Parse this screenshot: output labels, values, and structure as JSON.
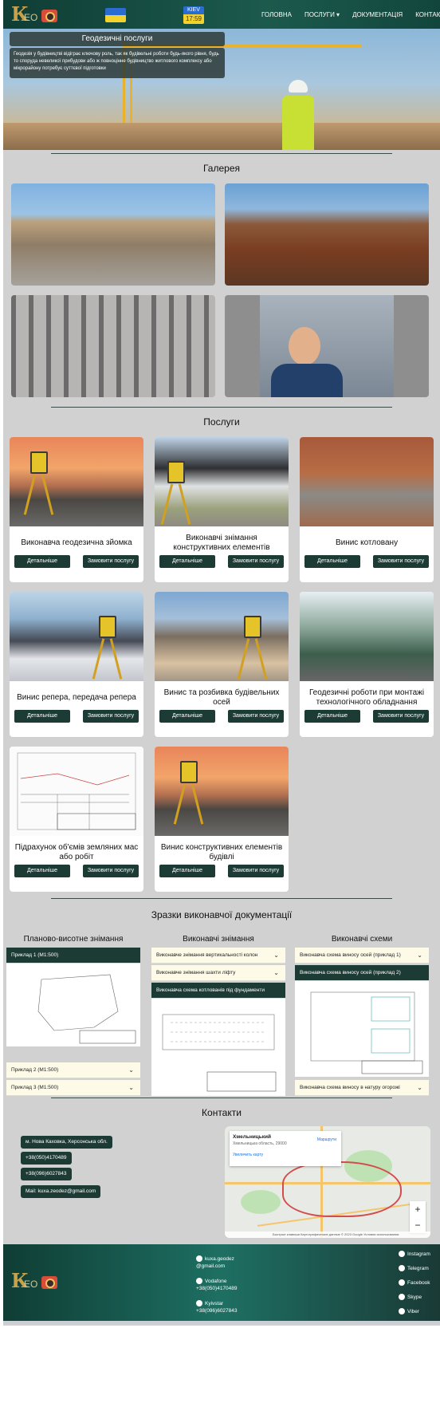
{
  "header": {
    "logo": {
      "letter": "К",
      "text": "ЕО"
    },
    "widget": {
      "city": "KIEV",
      "time": "17:59"
    },
    "nav": [
      {
        "label": "ГОЛОВНА"
      },
      {
        "label": "ПОСЛУГИ ▾"
      },
      {
        "label": "ДОКУМЕНТАЦІЯ"
      },
      {
        "label": "КОНТАКТИ"
      }
    ]
  },
  "hero": {
    "title": "Геодезичні послуги",
    "text": "Геодезія у будівництві відіграє ключову роль, так як будівельні роботи будь-якого рівня, будь то споруда невеликої прибудови або ж повноцінне будівництво житлового комплексу або мікрорайону потребує суттєвої підготовки"
  },
  "gallery": {
    "title": "Галерея"
  },
  "services": {
    "title": "Послуги",
    "details_label": "Детальніше",
    "order_label": "Замовити послугу",
    "items": [
      {
        "title": "Виконавча геодезична зйомка"
      },
      {
        "title": "Виконавчі знімання конструктивних елементів"
      },
      {
        "title": "Винис котловану"
      },
      {
        "title": "Винис репера, передача репера"
      },
      {
        "title": "Винис та розбивка будівельних осей"
      },
      {
        "title": "Геодезичні роботи при монтажі технологічного обладнання"
      },
      {
        "title": "Підрахунок об'ємів земляних мас або робіт"
      },
      {
        "title": "Винис конструктивних елементів будівлі"
      }
    ]
  },
  "docs": {
    "title": "Зразки виконавчої документації",
    "columns": [
      {
        "title": "Планово-висотне знімання",
        "items": [
          "Приклад 1 (М1:500)",
          "Приклад 2 (М1:500)",
          "Приклад 3 (М1:500)"
        ]
      },
      {
        "title": "Виконавчі знімання",
        "items": [
          "Виконавче знімання вертикальності колон",
          "Виконавче знімання шахти ліфту",
          "Виконавча схема котлованів під фундаменти"
        ]
      },
      {
        "title": "Виконавчі схеми",
        "items": [
          "Виконавча схема виносу осей (приклад 1)",
          "Виконавча схема виносу осей (приклад 2)",
          "Виконавча схема виносу в натуру огорожі"
        ]
      }
    ]
  },
  "contacts": {
    "title": "Контакти",
    "pills": [
      "м. Нова Каховка, Херсонська обл.",
      "+38(050)4170489",
      "+38(096)6027843",
      "Mail: kuxa.zeodez@gmail.com"
    ],
    "map": {
      "place": "Хмельницький",
      "region": "Хмельницька область, 29000",
      "routes": "Маршрути",
      "enlarge": "Увеличить карту",
      "footer": "Быстрые клавиши   Картографические данные © 2023 Google   Условия использования"
    }
  },
  "footer": {
    "email": "kuxa.geodez @gmail.com",
    "vodafone_label": "Vodafone",
    "vodafone_phone": "+38(050)4170489",
    "kyivstar_label": "Kyivstar",
    "kyivstar_phone": "+38(096)6027843",
    "social": [
      "Instagram",
      "Telegram",
      "Facebook",
      "Skype",
      "Viber"
    ]
  },
  "colors": {
    "primary": "#1d3b35",
    "header": "#0f3d34",
    "accent": "#f3d22e"
  }
}
